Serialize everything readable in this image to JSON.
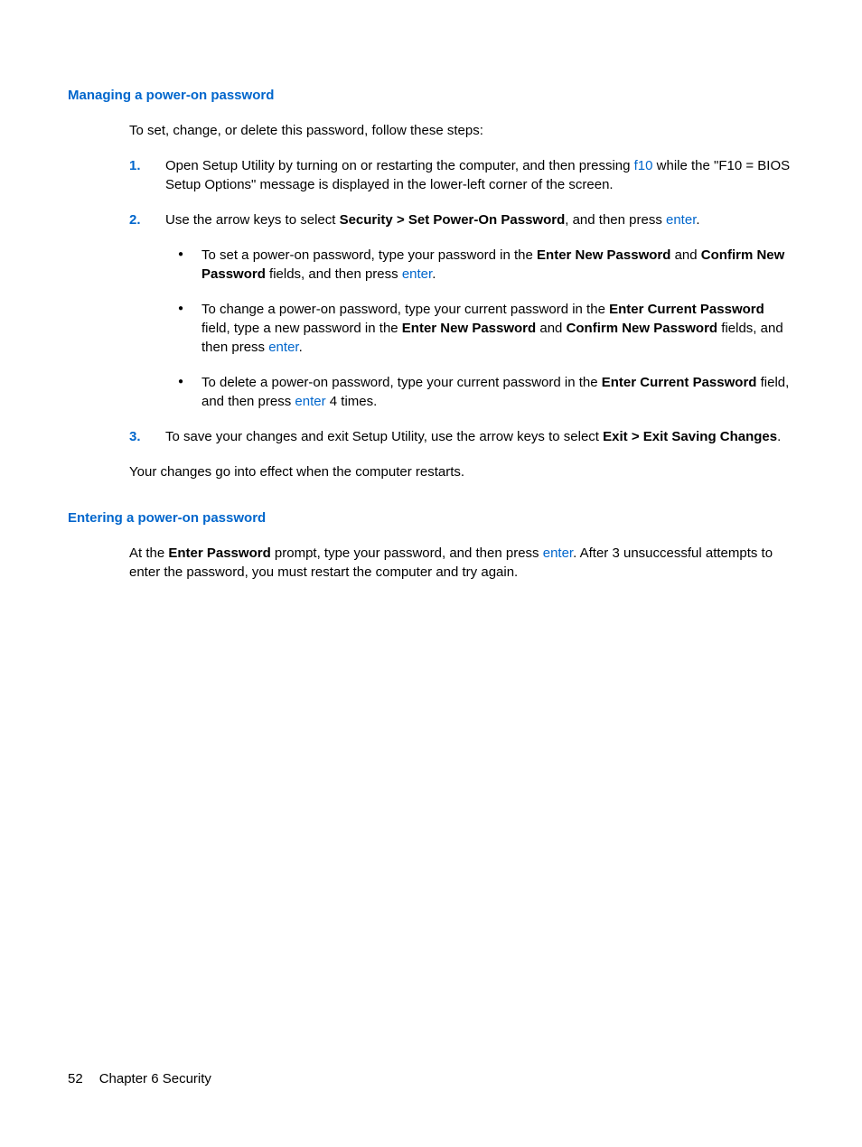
{
  "section1": {
    "heading": "Managing a power-on password",
    "intro": "To set, change, or delete this password, follow these steps:",
    "step1": {
      "pre": "Open Setup Utility by turning on or restarting the computer, and then pressing ",
      "key": "f10",
      "post": " while the \"F10 = BIOS Setup Options\" message is displayed in the lower-left corner of the screen."
    },
    "step2": {
      "pre": "Use the arrow keys to select ",
      "bold": "Security > Set Power-On Password",
      "mid": ", and then press ",
      "key": "enter",
      "post": ".",
      "bullet1": {
        "t1": "To set a power-on password, type your password in the ",
        "b1": "Enter New Password",
        "t2": " and ",
        "b2": "Confirm New Password",
        "t3": " fields, and then press ",
        "key": "enter",
        "t4": "."
      },
      "bullet2": {
        "t1": "To change a power-on password, type your current password in the ",
        "b1": "Enter Current Password",
        "t2": " field, type a new password in the ",
        "b2": "Enter New Password",
        "t3": " and ",
        "b3": "Confirm New Password",
        "t4": " fields, and then press ",
        "key": "enter",
        "t5": "."
      },
      "bullet3": {
        "t1": "To delete a power-on password, type your current password in the ",
        "b1": "Enter Current Password",
        "t2": " field, and then press ",
        "key": "enter",
        "t3": " 4 times."
      }
    },
    "step3": {
      "t1": "To save your changes and exit Setup Utility, use the arrow keys to select ",
      "b1": "Exit > Exit Saving Changes",
      "t2": "."
    },
    "closing": "Your changes go into effect when the computer restarts."
  },
  "section2": {
    "heading": "Entering a power-on password",
    "para": {
      "t1": "At the ",
      "b1": "Enter Password",
      "t2": " prompt, type your password, and then press ",
      "key": "enter",
      "t3": ". After 3 unsuccessful attempts to enter the password, you must restart the computer and try again."
    }
  },
  "footer": {
    "page": "52",
    "chapter": "Chapter 6   Security"
  }
}
